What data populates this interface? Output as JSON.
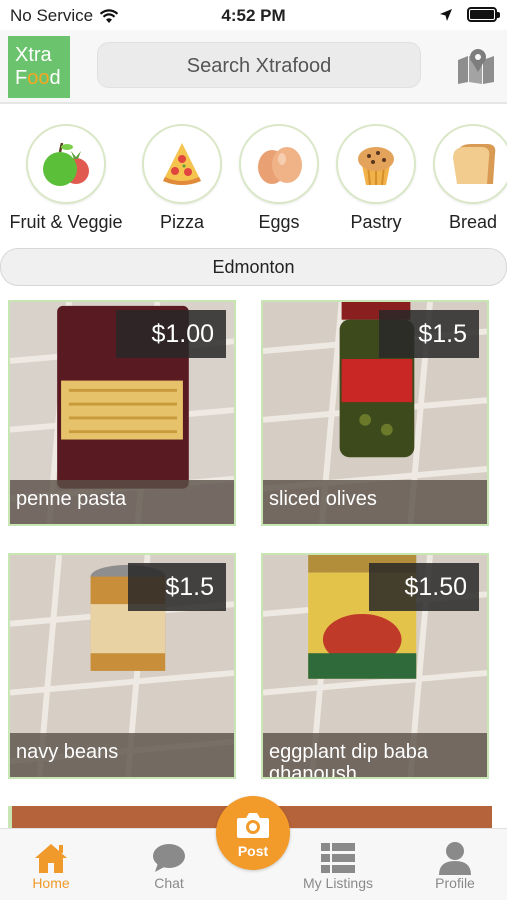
{
  "status_bar": {
    "carrier": "No Service",
    "time": "4:52 PM"
  },
  "header": {
    "logo_line1": "Xtra",
    "logo_line2_a": "F",
    "logo_line2_b": "oo",
    "logo_line2_c": "d",
    "search_placeholder": "Search Xtrafood",
    "map_icon": "map-pin-icon"
  },
  "categories": [
    {
      "label": "Fruit & Veggie",
      "icon": "fruit-veggie-icon"
    },
    {
      "label": "Pizza",
      "icon": "pizza-icon"
    },
    {
      "label": "Eggs",
      "icon": "eggs-icon"
    },
    {
      "label": "Pastry",
      "icon": "pastry-icon"
    },
    {
      "label": "Bread",
      "icon": "bread-icon"
    }
  ],
  "location": "Edmonton",
  "listings": [
    {
      "price": "$1.00",
      "name": "penne pasta"
    },
    {
      "price": "$1.5",
      "name": "sliced olives"
    },
    {
      "price": "$1.5",
      "name": "navy beans"
    },
    {
      "price": "$1.50",
      "name": "eggplant dip baba ghanoush"
    }
  ],
  "tabbar": {
    "home": "Home",
    "chat": "Chat",
    "post": "Post",
    "my_listings": "My Listings",
    "profile": "Profile",
    "accent": "#ef9a2b"
  }
}
